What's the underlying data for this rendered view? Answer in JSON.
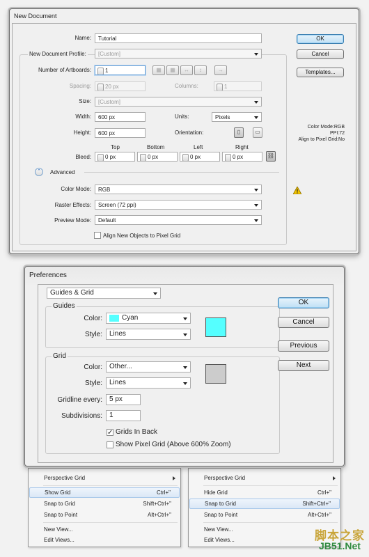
{
  "new_document": {
    "title": "New Document",
    "name_label": "Name:",
    "name_value": "Tutorial",
    "profile_label": "New Document Profile:",
    "profile_value": "[Custom]",
    "artboards_label": "Number of Artboards:",
    "artboards_value": "1",
    "spacing_label": "Spacing:",
    "spacing_value": "20 px",
    "columns_label": "Columns:",
    "columns_value": "1",
    "size_label": "Size:",
    "size_value": "[Custom]",
    "width_label": "Width:",
    "width_value": "600 px",
    "units_label": "Units:",
    "units_value": "Pixels",
    "height_label": "Height:",
    "height_value": "600 px",
    "orientation_label": "Orientation:",
    "bleed_label": "Bleed:",
    "bleed_top_label": "Top",
    "bleed_bottom_label": "Bottom",
    "bleed_left_label": "Left",
    "bleed_right_label": "Right",
    "bleed_top": "0 px",
    "bleed_bottom": "0 px",
    "bleed_left": "0 px",
    "bleed_right": "0 px",
    "advanced_label": "Advanced",
    "color_mode_label": "Color Mode:",
    "color_mode_value": "RGB",
    "raster_label": "Raster Effects:",
    "raster_value": "Screen (72 ppi)",
    "preview_label": "Preview Mode:",
    "preview_value": "Default",
    "align_label": "Align New Objects to Pixel Grid",
    "ok": "OK",
    "cancel": "Cancel",
    "templates": "Templates...",
    "info_line1": "Color Mode:RGB",
    "info_line2": "PPI:72",
    "info_line3": "Align to Pixel Grid:No"
  },
  "preferences": {
    "title": "Preferences",
    "section_value": "Guides & Grid",
    "guides_group": "Guides",
    "guides_color_label": "Color:",
    "guides_color_value": "Cyan",
    "guides_style_label": "Style:",
    "guides_style_value": "Lines",
    "grid_group": "Grid",
    "grid_color_label": "Color:",
    "grid_color_value": "Other...",
    "grid_style_label": "Style:",
    "grid_style_value": "Lines",
    "gridline_label": "Gridline every:",
    "gridline_value": "5 px",
    "subdiv_label": "Subdivisions:",
    "subdiv_value": "1",
    "grids_in_back": "Grids In Back",
    "show_pixel_grid": "Show Pixel Grid (Above 600% Zoom)",
    "ok": "OK",
    "cancel": "Cancel",
    "previous": "Previous",
    "next": "Next",
    "colors": {
      "cyan": "#55ffff",
      "grid_gray": "#cccccc"
    }
  },
  "menu_left": {
    "items": [
      {
        "label": "Perspective Grid",
        "shortcut": ""
      },
      {
        "label": "Show Grid",
        "shortcut": "Ctrl+\""
      },
      {
        "label": "Snap to Grid",
        "shortcut": "Shift+Ctrl+\""
      },
      {
        "label": "Snap to Point",
        "shortcut": "Alt+Ctrl+\""
      },
      {
        "label": "New View...",
        "shortcut": ""
      },
      {
        "label": "Edit Views...",
        "shortcut": ""
      }
    ]
  },
  "menu_right": {
    "items": [
      {
        "label": "Perspective Grid",
        "shortcut": ""
      },
      {
        "label": "Hide Grid",
        "shortcut": "Ctrl+\""
      },
      {
        "label": "Snap to Grid",
        "shortcut": "Shift+Ctrl+\""
      },
      {
        "label": "Snap to Point",
        "shortcut": "Alt+Ctrl+\""
      },
      {
        "label": "New View...",
        "shortcut": ""
      },
      {
        "label": "Edit Views...",
        "shortcut": ""
      }
    ]
  },
  "watermark": {
    "line1": "脚本之家",
    "line2": "JB51.Net"
  }
}
